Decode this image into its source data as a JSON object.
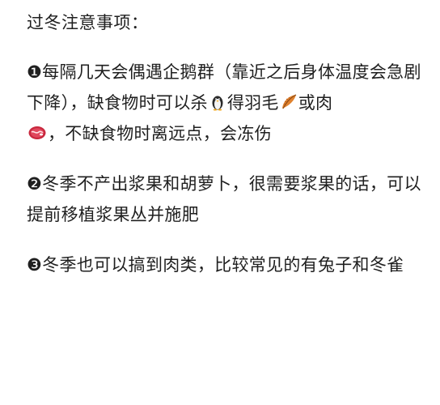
{
  "title": "过冬注意事项：",
  "tips": [
    {
      "num": "❶",
      "part1": "每隔几天会偶遇企鹅群（靠近之后身体温度会急剧下降），缺食物时可以杀",
      "part2": "得羽毛",
      "part3": "或肉",
      "part4": "，不缺食物时离远点，会冻伤"
    },
    {
      "num": "❷",
      "text": "冬季不产出浆果和胡萝卜，很需要浆果的话，可以提前移植浆果丛并施肥"
    },
    {
      "num": "❸",
      "text": "冬季也可以搞到肉类，比较常见的有兔子和冬雀"
    }
  ],
  "icons": {
    "penguin": "penguin-icon",
    "feather": "feather-icon",
    "meat": "meat-icon"
  }
}
